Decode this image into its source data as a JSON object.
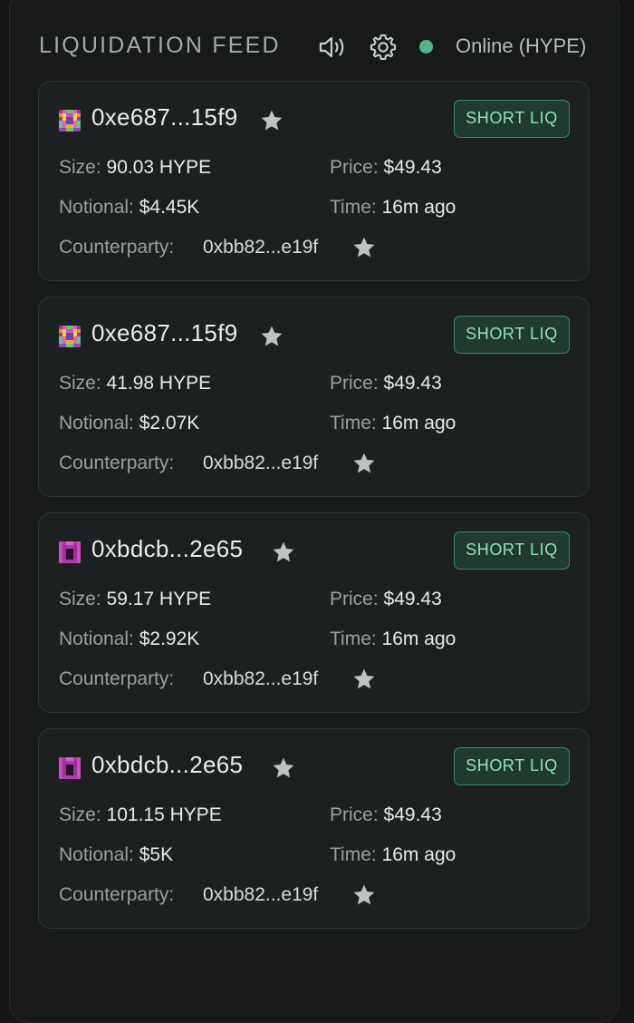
{
  "header": {
    "title": "LIQUIDATION FEED",
    "status": "Online (HYPE)"
  },
  "colors": {
    "status_online": "#4fb68b",
    "badge_text": "#8fe3bb",
    "badge_bg": "#1f3a2f"
  },
  "labels": {
    "size": "Size:",
    "price": "Price:",
    "notional": "Notional:",
    "time": "Time:",
    "counterparty": "Counterparty:"
  },
  "cards": [
    {
      "address": "0xe687...15f9",
      "badge": "SHORT LIQ",
      "size": "90.03 HYPE",
      "price": "$49.43",
      "notional": "$4.45K",
      "time": "16m ago",
      "counterparty": "0xbb82...e19f",
      "avatar_icon": "identicon-multicolor"
    },
    {
      "address": "0xe687...15f9",
      "badge": "SHORT LIQ",
      "size": "41.98 HYPE",
      "price": "$49.43",
      "notional": "$2.07K",
      "time": "16m ago",
      "counterparty": "0xbb82...e19f",
      "avatar_icon": "identicon-multicolor"
    },
    {
      "address": "0xbdcb...2e65",
      "badge": "SHORT LIQ",
      "size": "59.17 HYPE",
      "price": "$49.43",
      "notional": "$2.92K",
      "time": "16m ago",
      "counterparty": "0xbb82...e19f",
      "avatar_icon": "identicon-magenta"
    },
    {
      "address": "0xbdcb...2e65",
      "badge": "SHORT LIQ",
      "size": "101.15 HYPE",
      "price": "$49.43",
      "notional": "$5K",
      "time": "16m ago",
      "counterparty": "0xbb82...e19f",
      "avatar_icon": "identicon-magenta"
    }
  ]
}
